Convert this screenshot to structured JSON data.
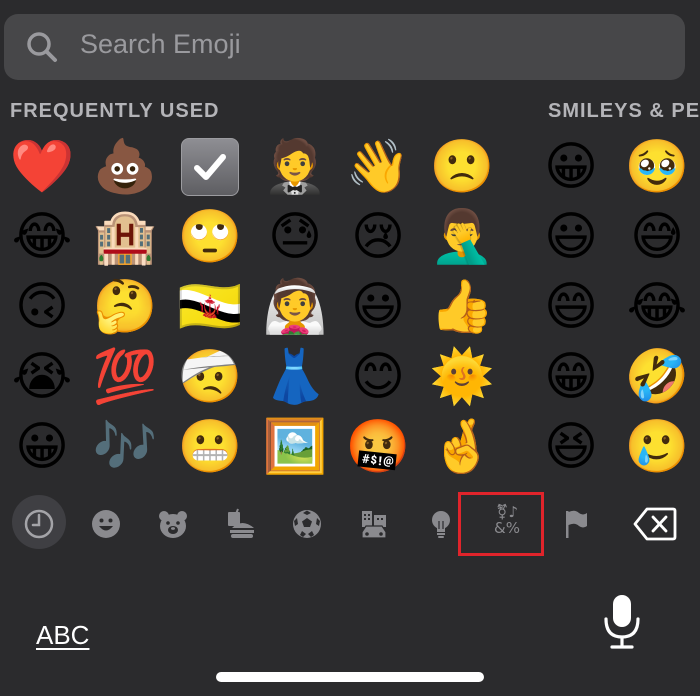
{
  "search": {
    "placeholder": "Search Emoji"
  },
  "sections": {
    "frequently_used": "FREQUENTLY USED",
    "smileys": "SMILEYS & PE"
  },
  "frequently_used": [
    [
      "❤️",
      "💩",
      "check",
      "🤵",
      "👋",
      "🙁"
    ],
    [
      "😂",
      "🏨",
      "🙄",
      "😓",
      "😢",
      "🤦‍♂️"
    ],
    [
      "🙃",
      "🤔",
      "🇧🇳",
      "👰",
      "😃",
      "👍"
    ],
    [
      "😭",
      "💯",
      "🤕",
      "👗",
      "😊",
      "🌞"
    ],
    [
      "😀",
      "🎶",
      "😬",
      "🖼️",
      "🤬",
      "🤞"
    ]
  ],
  "smileys": [
    [
      "😀",
      "🥹"
    ],
    [
      "😃",
      "😅"
    ],
    [
      "😄",
      "😂"
    ],
    [
      "😁",
      "🤣"
    ],
    [
      "😆",
      "🥲"
    ]
  ],
  "categories": [
    {
      "name": "recent",
      "icon": "clock-icon"
    },
    {
      "name": "smileys",
      "icon": "smiley-icon"
    },
    {
      "name": "animals",
      "icon": "bear-icon"
    },
    {
      "name": "food",
      "icon": "burger-icon"
    },
    {
      "name": "activity",
      "icon": "soccer-ball-icon"
    },
    {
      "name": "travel",
      "icon": "buildings-car-icon"
    },
    {
      "name": "objects",
      "icon": "lightbulb-icon"
    },
    {
      "name": "symbols",
      "icon": "symbols-icon"
    },
    {
      "name": "flags",
      "icon": "flag-icon"
    }
  ],
  "symbols_glyph": {
    "top": "⚧♪",
    "bottom": "&%"
  },
  "selected_category": "recent",
  "highlighted_category": "symbols",
  "keyboard": {
    "abc_label": "ABC"
  },
  "colors": {
    "background": "#2b2b2d",
    "search_bg": "#474749",
    "section_text": "#b4b4b8",
    "highlight": "#e0242b"
  }
}
